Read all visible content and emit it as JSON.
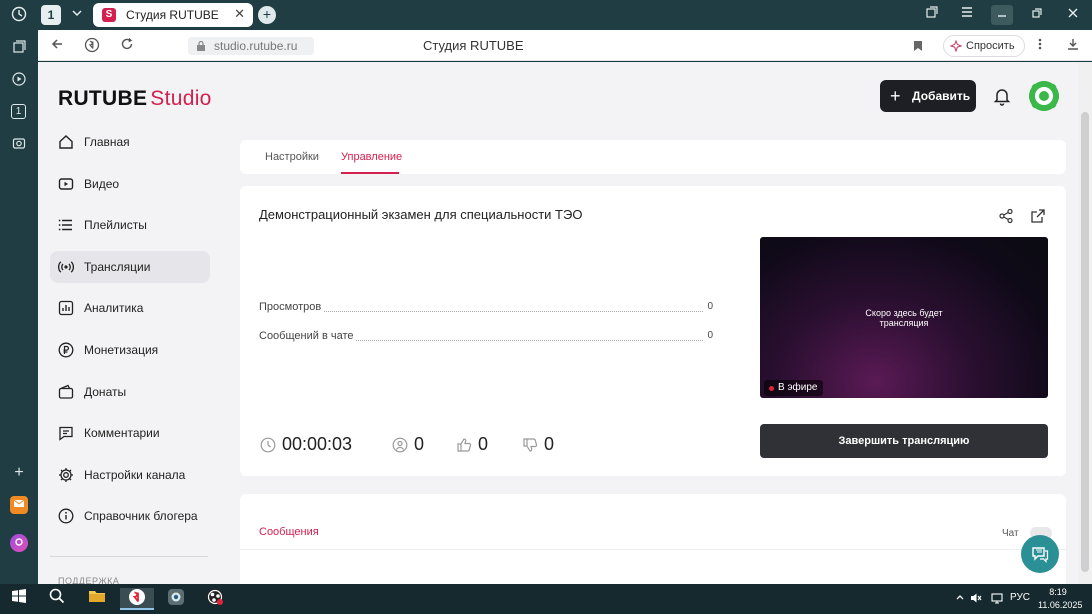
{
  "browser": {
    "tab_count": "1",
    "tab_title": "Студия RUTUBE",
    "tab_favicon": "S",
    "url": "studio.rutube.ru",
    "page_title": "Студия RUTUBE",
    "ask_label": "Спросить"
  },
  "header": {
    "logo_main": "RUTUBE",
    "logo_sub": "Studio",
    "add_label": "Добавить"
  },
  "menu": {
    "items": [
      {
        "label": "Главная",
        "icon": "home-icon"
      },
      {
        "label": "Видео",
        "icon": "video-icon"
      },
      {
        "label": "Плейлисты",
        "icon": "playlist-icon"
      },
      {
        "label": "Трансляции",
        "icon": "broadcast-icon",
        "active": true
      },
      {
        "label": "Аналитика",
        "icon": "analytics-icon"
      },
      {
        "label": "Монетизация",
        "icon": "ruble-icon"
      },
      {
        "label": "Донаты",
        "icon": "wallet-icon"
      },
      {
        "label": "Комментарии",
        "icon": "comment-icon"
      },
      {
        "label": "Настройки канала",
        "icon": "settings-icon"
      },
      {
        "label": "Справочник блогера",
        "icon": "info-icon"
      }
    ],
    "support_label": "Поддержка"
  },
  "page_tabs": [
    {
      "label": "Настройки",
      "active": false
    },
    {
      "label": "Управление",
      "active": true
    }
  ],
  "stream": {
    "title": "Демонстрационный экзамен для специальности ТЭО",
    "stats": [
      {
        "label": "Просмотров",
        "value": "0"
      },
      {
        "label": "Сообщений в чате",
        "value": "0"
      }
    ],
    "timer": "00:00:03",
    "viewers": "0",
    "likes": "0",
    "dislikes": "0",
    "preview_text_line1": "Скоро здесь будет",
    "preview_text_line2": "трансляция",
    "live_badge": "В эфире",
    "end_button": "Завершить трансляцию"
  },
  "messages": {
    "tab_label": "Сообщения",
    "chat_label": "Чат"
  },
  "taskbar": {
    "time": "8:19",
    "date": "11.06.2025",
    "lang": "РУС"
  },
  "colors": {
    "accent": "#d3204f",
    "dark_button": "#1d1f24",
    "help_button": "#2b8f96"
  }
}
